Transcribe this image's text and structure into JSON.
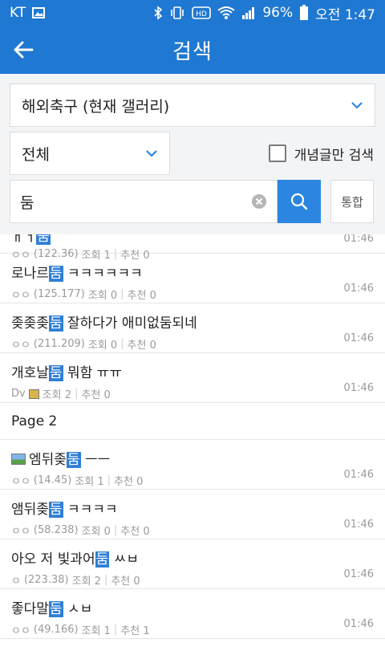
{
  "status": {
    "carrier": "KT",
    "battery": "96%",
    "time": "오전 1:47"
  },
  "appbar": {
    "title": "검색"
  },
  "filters": {
    "gallery": "해외축구 (현재 갤러리)",
    "scope": "전체",
    "concept_label": "개념글만 검색",
    "search_value": "둠",
    "unified_label": "통합"
  },
  "results_first": {
    "title_hl": "둠",
    "nick": "ㅇㅇ",
    "ip": "(122.36)",
    "views": "조회 1",
    "likes": "추천 0",
    "time": "01:46"
  },
  "results": [
    {
      "pre": "로나르",
      "hl": "둠",
      "post": " ㅋㅋㅋㅋㅋㅋ",
      "nick": "ㅇㅇ",
      "ip": "(125.177)",
      "views": "조회 0",
      "likes": "추천 0",
      "time": "01:46"
    },
    {
      "pre": "좆좆좆",
      "hl": "둠",
      "post": " 잘하다가 애미없둠되네",
      "nick": "ㅇㅇ",
      "ip": "(211.209)",
      "views": "조회 0",
      "likes": "추천 0",
      "time": "01:46"
    },
    {
      "pre": "개호날",
      "hl": "둠",
      "post": " 뭐함 ㅠㅠ",
      "nick": "Dv",
      "ip": "",
      "views": "조회 2",
      "likes": "추천 0",
      "time": "01:46"
    }
  ],
  "page2_label": "Page 2",
  "results_p2": [
    {
      "pre": "엠뒤좆",
      "hl": "둠",
      "post": " ㅡㅡ",
      "nick": "ㅇㅇ",
      "ip": "(14.45)",
      "views": "조회 1",
      "likes": "추천 0",
      "time": "01:46"
    },
    {
      "pre": "앰뒤좆",
      "hl": "둠",
      "post": " ㅋㅋㅋㅋ",
      "nick": "ㅇㅇ",
      "ip": "(58.238)",
      "views": "조회 0",
      "likes": "추천 0",
      "time": "01:46"
    },
    {
      "pre": "아오 저 빛과어",
      "hl": "둠",
      "post": " ㅆㅂ",
      "nick": "ㅇ",
      "ip": "(223.38)",
      "views": "조회 2",
      "likes": "추천 0",
      "time": "01:46"
    },
    {
      "pre": "좋다말",
      "hl": "둠",
      "post": " ㅅㅂ",
      "nick": "ㅇㅇ",
      "ip": "(49.166)",
      "views": "조회 1",
      "likes": "추천 1",
      "time": "01:46"
    }
  ]
}
